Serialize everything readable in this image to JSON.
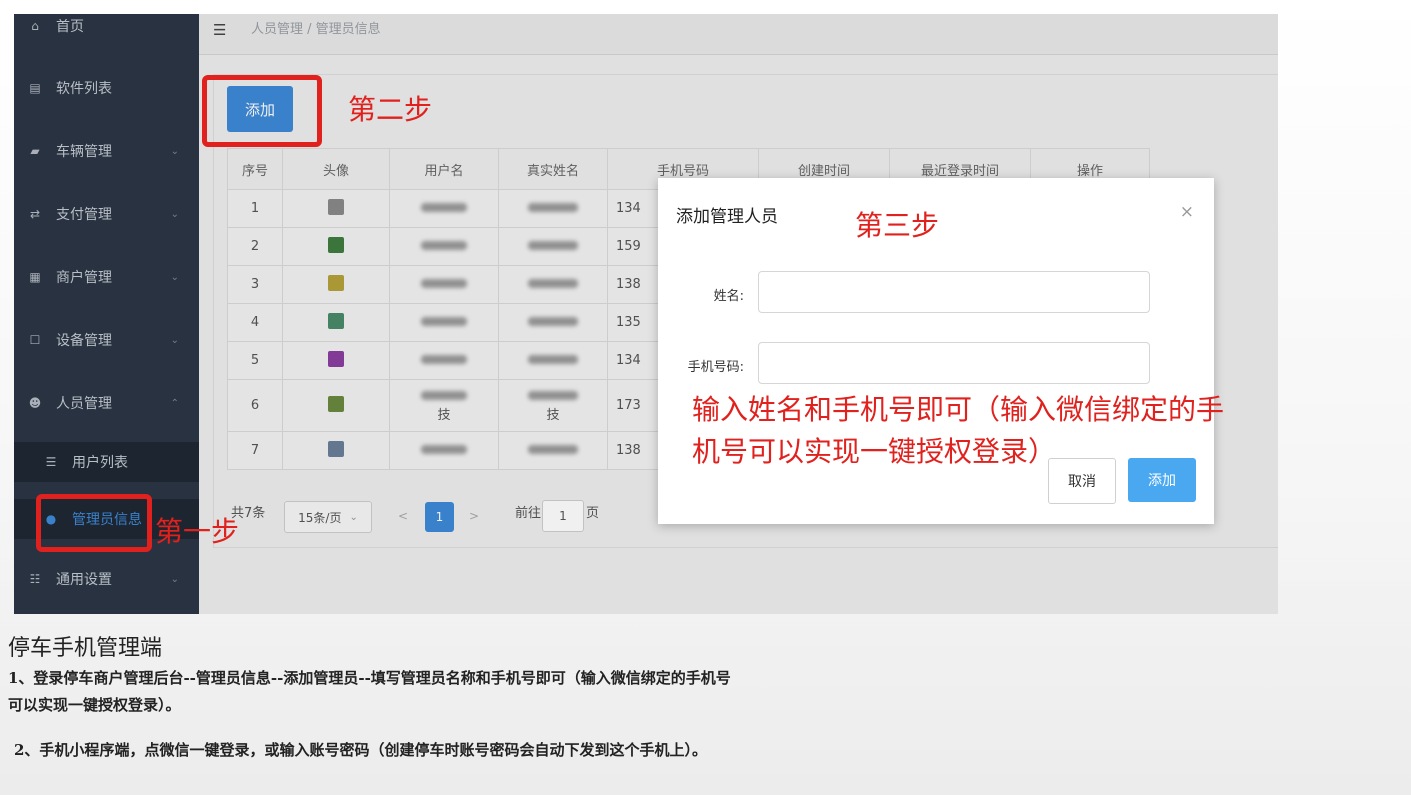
{
  "sidebar": {
    "items": [
      {
        "icon": "home-icon",
        "label": "首页"
      },
      {
        "icon": "doc-icon",
        "label": "软件列表"
      },
      {
        "icon": "car-icon",
        "label": "车辆管理"
      },
      {
        "icon": "swap-icon",
        "label": "支付管理"
      },
      {
        "icon": "store-icon",
        "label": "商户管理"
      },
      {
        "icon": "device-icon",
        "label": "设备管理"
      },
      {
        "icon": "people-icon",
        "label": "人员管理"
      },
      {
        "icon": "list-icon",
        "label": "用户列表"
      },
      {
        "icon": "user-icon",
        "label": "管理员信息"
      },
      {
        "icon": "settings-icon",
        "label": "通用设置"
      }
    ]
  },
  "header": {
    "breadcrumb": "人员管理 / 管理员信息"
  },
  "toolbar": {
    "add_label": "添加"
  },
  "annotations": {
    "step1": "第一步",
    "step2": "第二步",
    "step3": "第三步",
    "note_line1": "输入姓名和手机号即可（输入微信绑定的手",
    "note_line2": "机号可以实现一键授权登录）"
  },
  "table": {
    "headers": [
      "序号",
      "头像",
      "用户名",
      "真实姓名",
      "手机号码",
      "创建时间",
      "最近登录时间",
      "操作"
    ],
    "rows": [
      {
        "index": "1",
        "phone": "134",
        "name_tail": "",
        "real_tail": ""
      },
      {
        "index": "2",
        "phone": "159",
        "name_tail": "",
        "real_tail": ""
      },
      {
        "index": "3",
        "phone": "138",
        "name_tail": "",
        "real_tail": ""
      },
      {
        "index": "4",
        "phone": "135",
        "name_tail": "",
        "real_tail": ""
      },
      {
        "index": "5",
        "phone": "134",
        "name_tail": "",
        "real_tail": ""
      },
      {
        "index": "6",
        "phone": "173",
        "name_tail": "技",
        "real_tail": "技"
      },
      {
        "index": "7",
        "phone": "138",
        "name_tail": "",
        "real_tail": ""
      }
    ],
    "avatar_colors": [
      "#8a8a8a",
      "#3f7d3f",
      "#b5a23a",
      "#4a8a6a",
      "#8a3fa0",
      "#6a8a3f",
      "#6a7f9a"
    ]
  },
  "pager": {
    "total": "共7条",
    "page_size": "15条/页",
    "prev": "<",
    "current": "1",
    "next": ">",
    "goto_label": "前往",
    "goto_value": "1",
    "page_unit": "页"
  },
  "modal": {
    "title": "添加管理人员",
    "close": "×",
    "name_label": "姓名:",
    "phone_label": "手机号码:",
    "cancel": "取消",
    "confirm": "添加"
  },
  "caption": {
    "title": "停车手机管理端",
    "line1": "1、登录停车商户管理后台--管理员信息--添加管理员--填写管理员名称和手机号即可（输入微信绑定的手机号",
    "line2": "可以实现一键授权登录）。",
    "line3": "2、手机小程序端，点微信一键登录，或输入账号密码（创建停车时账号密码会自动下发到这个手机上）。"
  }
}
